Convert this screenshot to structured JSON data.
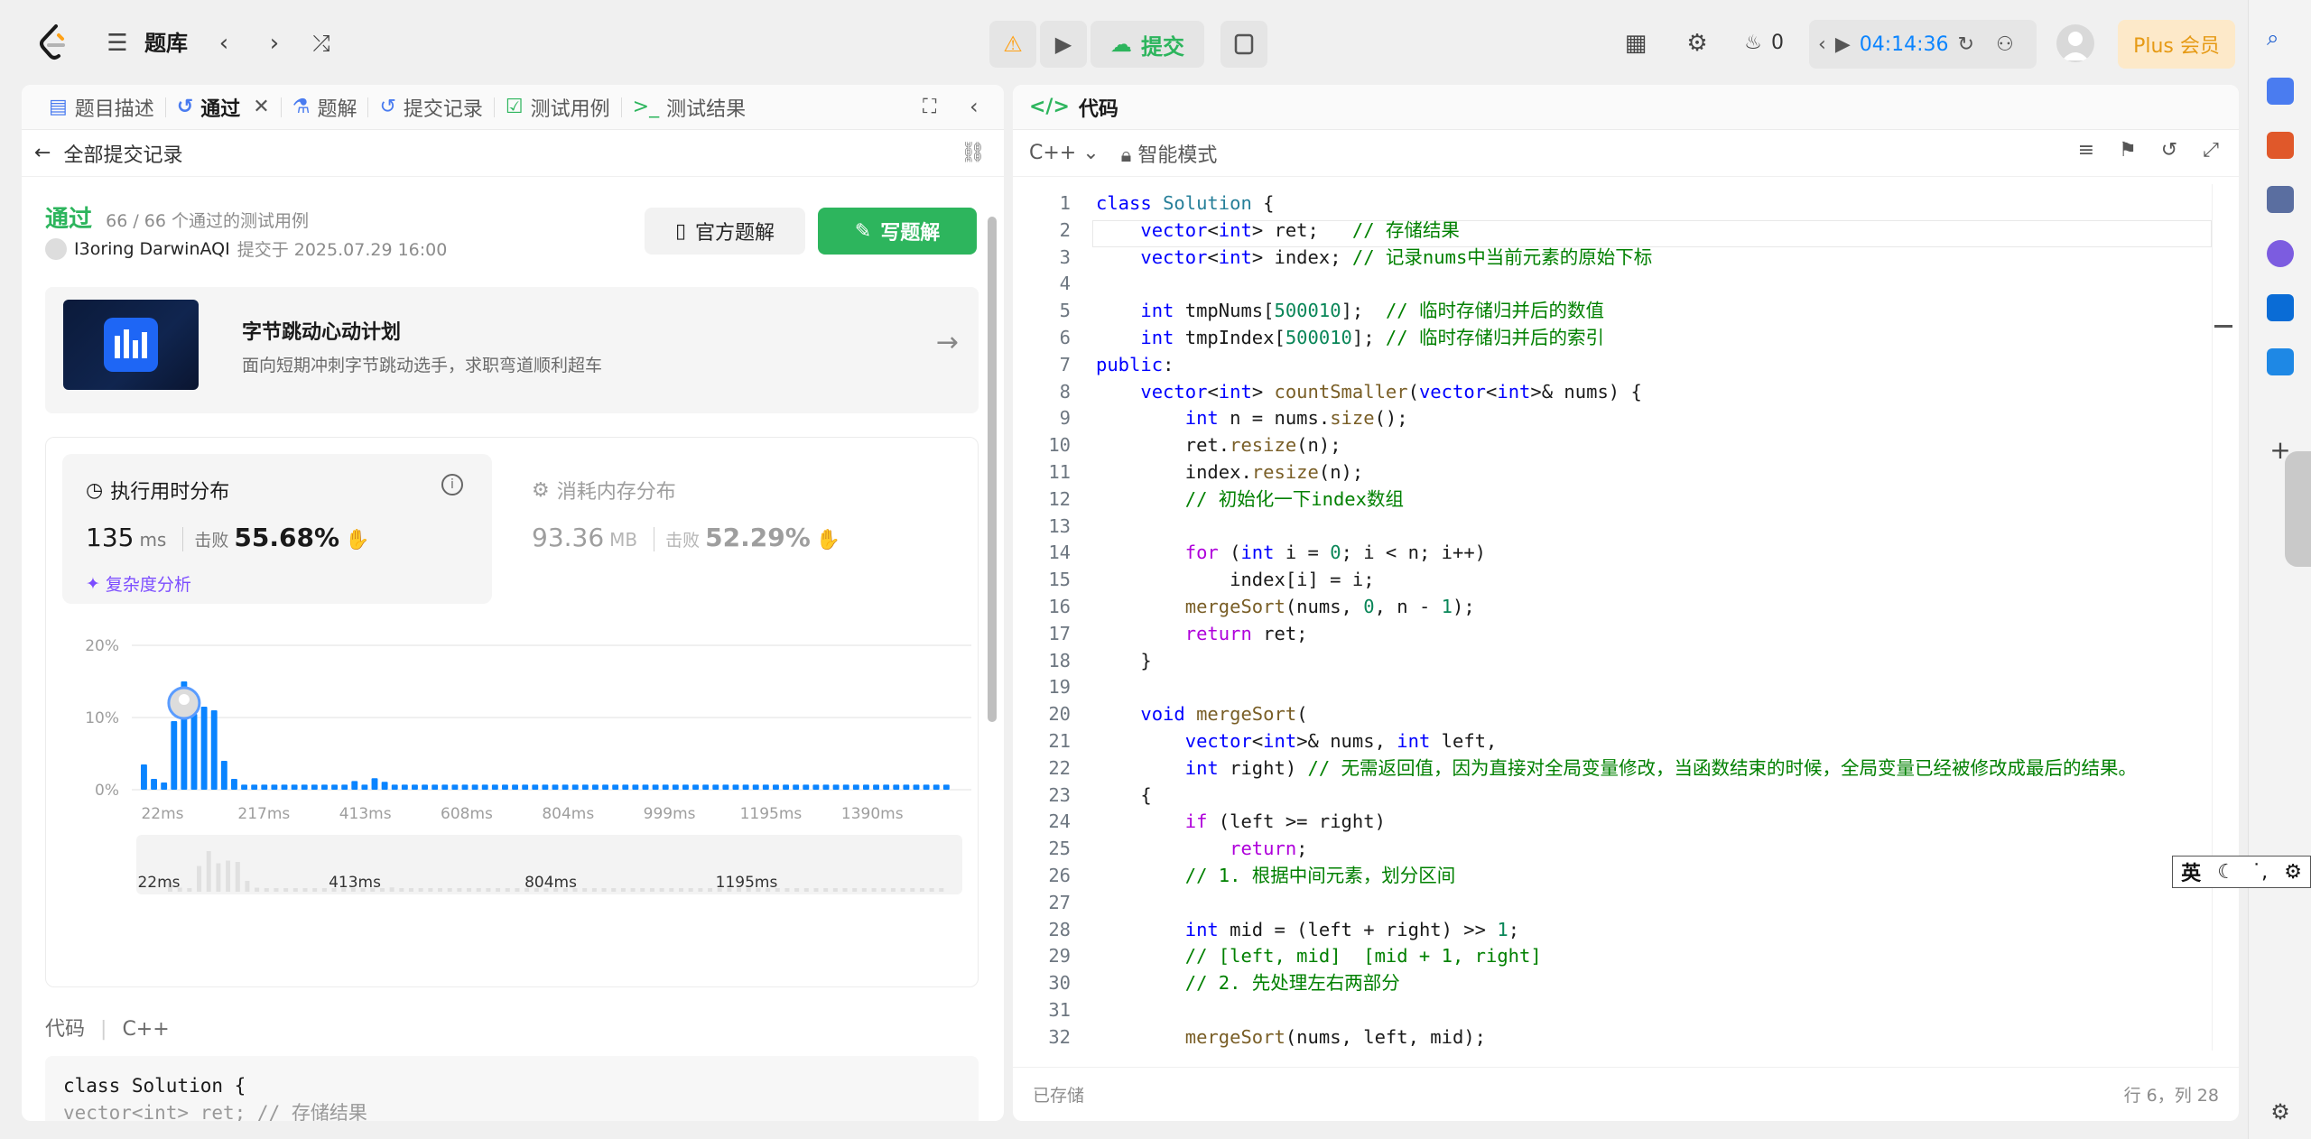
{
  "topbar": {
    "problem_bank": "题库",
    "submit_label": "提交",
    "streak_count": "0",
    "timer": "04:14:36",
    "plus_label": "Plus 会员"
  },
  "left": {
    "tabs": [
      {
        "label": "题目描述"
      },
      {
        "label": "通过"
      },
      {
        "label": "题解"
      },
      {
        "label": "提交记录"
      },
      {
        "label": "测试用例"
      },
      {
        "label": "测试结果"
      }
    ],
    "back_label": "全部提交记录",
    "status": "通过",
    "pass_count": "66 / 66 个通过的测试用例",
    "author": "I3oring DarwinAQI",
    "submitted_at": "提交于 2025.07.29 16:00",
    "official_solution": "官方题解",
    "write_solution": "写题解",
    "promo_title": "字节跳动心动计划",
    "promo_sub": "面向短期冲刺字节跳动选手，求职弯道顺利超车",
    "runtime_title": "执行用时分布",
    "runtime_value": "135",
    "runtime_unit": "ms",
    "beat_label": "击败",
    "runtime_pct": "55.68%",
    "complexity_label": "复杂度分析",
    "memory_title": "消耗内存分布",
    "memory_value": "93.36",
    "memory_unit": "MB",
    "memory_pct": "52.29%",
    "code_label": "代码",
    "code_lang": "C++",
    "preview_line1": "class Solution {",
    "preview_line2": "    vector<int> ret;   // 存储结果"
  },
  "chart_data": {
    "type": "bar",
    "y_ticks": [
      "20%",
      "10%",
      "0%"
    ],
    "x_ticks": [
      "22ms",
      "217ms",
      "413ms",
      "608ms",
      "804ms",
      "999ms",
      "1195ms",
      "1390ms"
    ],
    "mini_ticks": [
      "22ms",
      "413ms",
      "804ms",
      "1195ms"
    ],
    "ylim": [
      0,
      20
    ],
    "values": [
      3.5,
      1.5,
      1,
      9.5,
      15,
      10.5,
      11.5,
      11,
      4,
      1.5,
      0.7,
      0.7,
      0.7,
      0.7,
      0.7,
      0.7,
      0.7,
      0.7,
      0.7,
      0.7,
      0.7,
      1.2,
      0.7,
      1.6,
      1.1,
      0.7,
      0.7,
      0.7,
      0.7,
      0.7,
      0.7,
      0.7,
      0.7,
      0.7,
      0.7,
      0.7,
      0.7,
      0.7,
      0.7,
      0.7,
      0.7,
      0.7,
      0.7,
      0.7,
      0.7,
      0.7,
      0.7,
      0.7,
      0.7,
      0.7,
      0.7,
      0.7,
      0.7,
      0.7,
      0.7,
      0.7,
      0.7,
      0.7,
      0.7,
      0.7,
      0.7,
      0.7,
      0.7,
      0.7,
      0.7,
      0.7,
      0.7,
      0.7,
      0.7,
      0.7,
      0.7,
      0.7,
      0.7,
      0.7,
      0.7,
      0.7,
      0.7,
      0.7,
      0.7,
      0.7,
      0.7
    ],
    "highlight_index": 4,
    "colors": {
      "bar": "#0a84ff",
      "grid": "#ececec",
      "label": "#9e9e9e"
    }
  },
  "editor": {
    "title": "代码",
    "language": "C++",
    "mode": "智能模式",
    "saved": "已存储",
    "cursor": "行 6，列 28",
    "lines": [
      "class Solution {",
      "    vector<int> ret;   // 存储结果",
      "    vector<int> index; // 记录nums中当前元素的原始下标",
      "",
      "    int tmpNums[500010];  // 临时存储归并后的数值",
      "    int tmpIndex[500010]; // 临时存储归并后的索引",
      "public:",
      "    vector<int> countSmaller(vector<int>& nums) {",
      "        int n = nums.size();",
      "        ret.resize(n);",
      "        index.resize(n);",
      "        // 初始化一下index数组",
      "",
      "        for (int i = 0; i < n; i++)",
      "            index[i] = i;",
      "        mergeSort(nums, 0, n - 1);",
      "        return ret;",
      "    }",
      "",
      "    void mergeSort(",
      "        vector<int>& nums, int left,",
      "        int right) // 无需返回值，因为直接对全局变量修改，当函数结束的时候，全局变量已经被修改成最后的结果。",
      "    {",
      "        if (left >= right)",
      "            return;",
      "        // 1. 根据中间元素，划分区间",
      "",
      "        int mid = (left + right) >> 1;",
      "        // [left, mid]  [mid + 1, right]",
      "        // 2. 先处理左右两部分",
      "",
      "        mergeSort(nums, left, mid);"
    ]
  },
  "ime": {
    "lang": "英"
  }
}
